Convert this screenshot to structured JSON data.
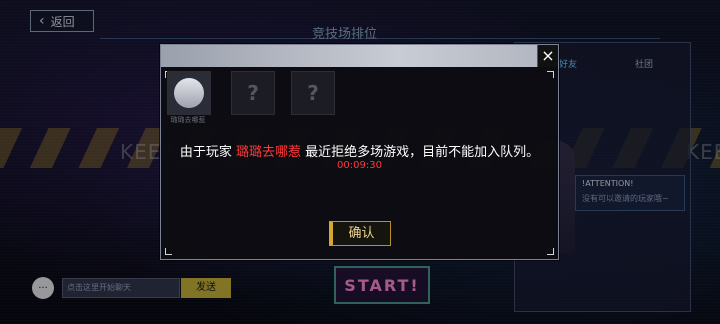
{
  "nav": {
    "back_label": "返回",
    "page_title": "竞技场排位"
  },
  "background": {
    "tape_text_left": "KEEP O",
    "tape_text_right": "KEEP"
  },
  "right_panel": {
    "tabs": [
      "好友",
      "社团"
    ],
    "notice_label": "!ATTENTION!",
    "notice_text": "没有可以邀请的玩家哦~"
  },
  "chat": {
    "placeholder": "点击这里开始聊天",
    "send_label": "发送"
  },
  "start_button": {
    "label": "START!"
  },
  "dialog": {
    "message_before": "由于玩家 ",
    "player_name": "璐璐去哪惹",
    "message_after": " 最近拒绝多场游戏，目前不能加入队列。",
    "timer": "00:09:30",
    "confirm_label": "确认",
    "slot_name": "璐璐去哪惹",
    "slot_unknown": "?",
    "close_symbol": "×"
  },
  "colors": {
    "highlight_red": "#ff3a3a",
    "confirm_gold": "#d4a833",
    "send_yellow": "#c8b23a"
  }
}
